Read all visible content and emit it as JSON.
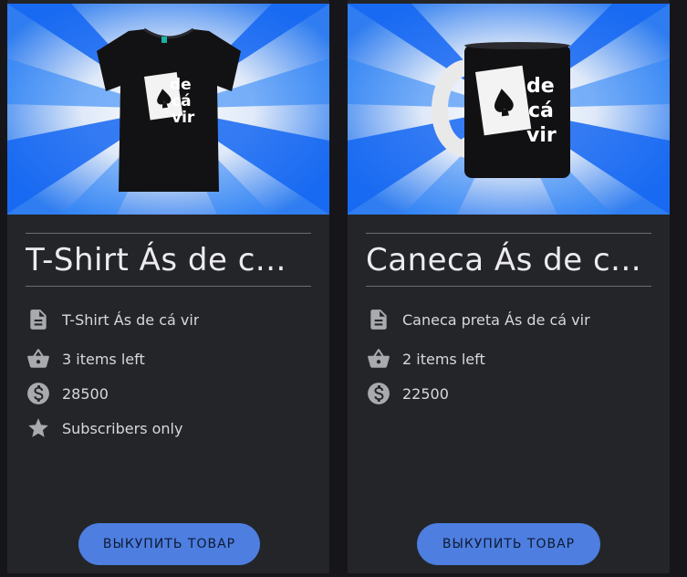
{
  "products": [
    {
      "title": "T-Shirt Ás de c...",
      "description": "T-Shirt Ás de cá vir",
      "stock": "3 items left",
      "price": "28500",
      "access": "Subscribers only",
      "buy_label": "ВЫКУПИТЬ ТОВАР",
      "image_kind": "t-shirt",
      "logo_text": [
        "de",
        "cá",
        "vir"
      ]
    },
    {
      "title": "Caneca Ás de c...",
      "description": "Caneca preta Ás de cá vir",
      "stock": "2 items left",
      "price": "22500",
      "buy_label": "ВЫКУПИТЬ ТОВАР",
      "image_kind": "mug",
      "logo_text": [
        "de",
        "cá",
        "vir"
      ]
    }
  ],
  "icons": {
    "description": "document-icon",
    "stock": "basket-icon",
    "price": "dollar-coin-icon",
    "access": "star-icon"
  },
  "colors": {
    "page_bg": "#16161a",
    "card_bg": "#242529",
    "button_bg": "#4d7ee0",
    "icon": "#a9aaae",
    "image_ray_dark": "#1465f5",
    "image_ray_light": "#eef3fb"
  }
}
